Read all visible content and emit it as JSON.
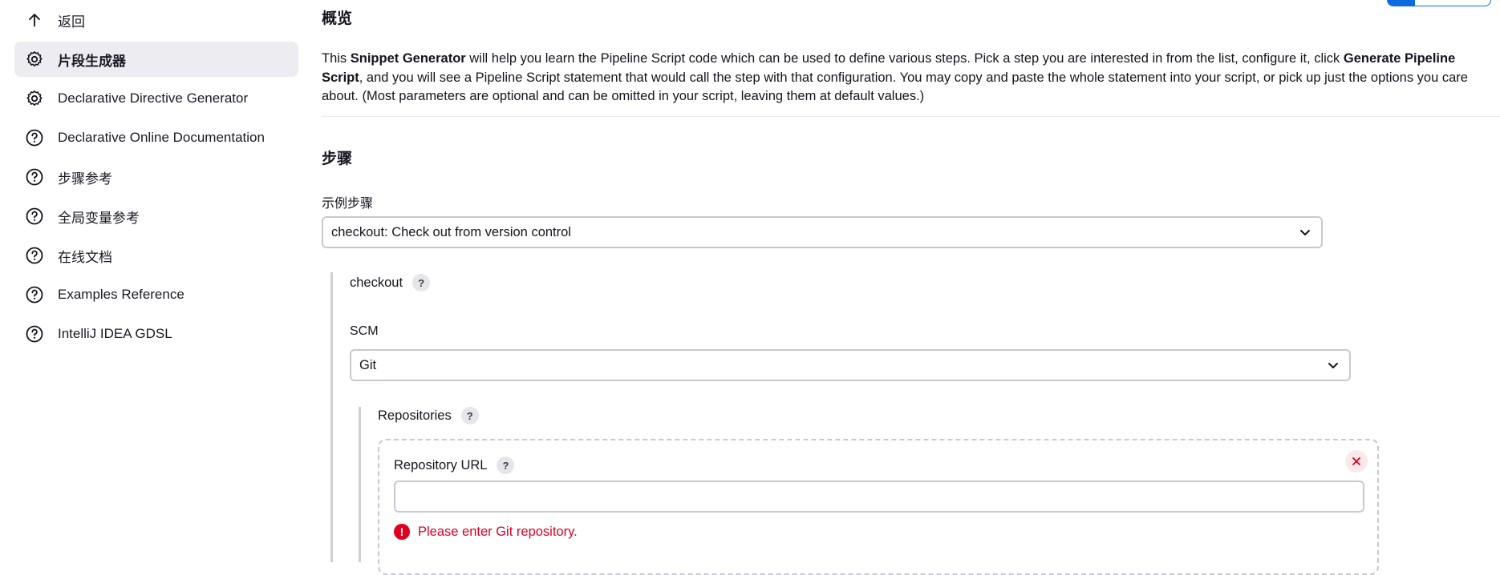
{
  "sidebar": {
    "items": [
      {
        "label": "返回",
        "icon": "arrow-up-icon"
      },
      {
        "label": "片段生成器",
        "icon": "gear-icon",
        "active": true
      },
      {
        "label": "Declarative Directive Generator",
        "icon": "gear-icon"
      },
      {
        "label": "Declarative Online Documentation",
        "icon": "help-circle-icon"
      },
      {
        "label": "步骤参考",
        "icon": "help-circle-icon"
      },
      {
        "label": "全局变量参考",
        "icon": "help-circle-icon"
      },
      {
        "label": "在线文档",
        "icon": "help-circle-icon"
      },
      {
        "label": "Examples Reference",
        "icon": "help-circle-icon"
      },
      {
        "label": "IntelliJ IDEA GDSL",
        "icon": "help-circle-icon"
      }
    ]
  },
  "overview": {
    "title": "概览",
    "desc_1": "This ",
    "desc_bold_1": "Snippet Generator",
    "desc_2": " will help you learn the Pipeline Script code which can be used to define various steps. Pick a step you are interested in from the list, configure it, click ",
    "desc_bold_2": "Generate Pipeline Script",
    "desc_3": ", and you will see a Pipeline Script statement that would call the step with that configuration. You may copy and paste the whole statement into your script, or pick up just the options you care about. (Most parameters are optional and can be omitted in your script, leaving them at default values.)"
  },
  "steps": {
    "title": "步骤",
    "sample_label": "示例步骤",
    "sample_value": "checkout: Check out from version control",
    "checkout_label": "checkout",
    "scm_label": "SCM",
    "scm_value": "Git",
    "repositories_label": "Repositories",
    "repo_url_label": "Repository URL",
    "repo_url_value": "",
    "help_glyph": "?",
    "error_text": "Please enter Git repository."
  },
  "colors": {
    "accent": "#0b6bde",
    "error": "#d90023",
    "active_bg": "#ececf1"
  }
}
